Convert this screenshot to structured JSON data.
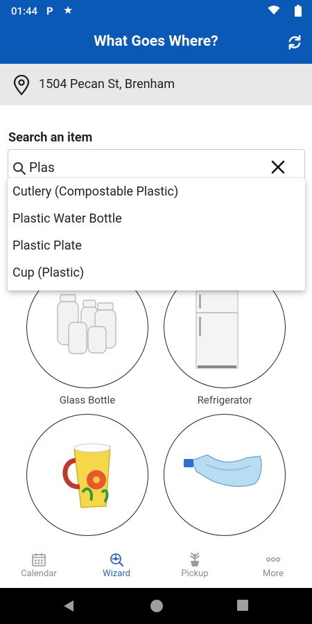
{
  "status_bar": {
    "time": "01:44",
    "icons": [
      "parking-icon",
      "star-icon",
      "wifi-icon",
      "battery-icon"
    ]
  },
  "app_bar": {
    "title": "What Goes Where?",
    "action_icon": "refresh-icon"
  },
  "location": {
    "address": "1504 Pecan St, Brenham"
  },
  "search": {
    "label": "Search an item",
    "value": "Plas",
    "suggestions": [
      "Cutlery (Compostable Plastic)",
      "Plastic Water Bottle",
      "Plastic Plate",
      "Cup (Plastic)"
    ]
  },
  "items": [
    {
      "label": "Glass Bottle"
    },
    {
      "label": "Refrigerator"
    },
    {
      "label": ""
    },
    {
      "label": ""
    }
  ],
  "bottom_nav": {
    "active": "Wizard",
    "items": [
      {
        "label": "Calendar",
        "icon": "calendar-icon"
      },
      {
        "label": "Wizard",
        "icon": "wizard-icon"
      },
      {
        "label": "Pickup",
        "icon": "pickup-icon"
      },
      {
        "label": "More",
        "icon": "more-icon"
      }
    ]
  },
  "colors": {
    "brand": "#0b59b6",
    "active_nav": "#2f66c2",
    "inactive_nav": "#8a8a8a"
  }
}
